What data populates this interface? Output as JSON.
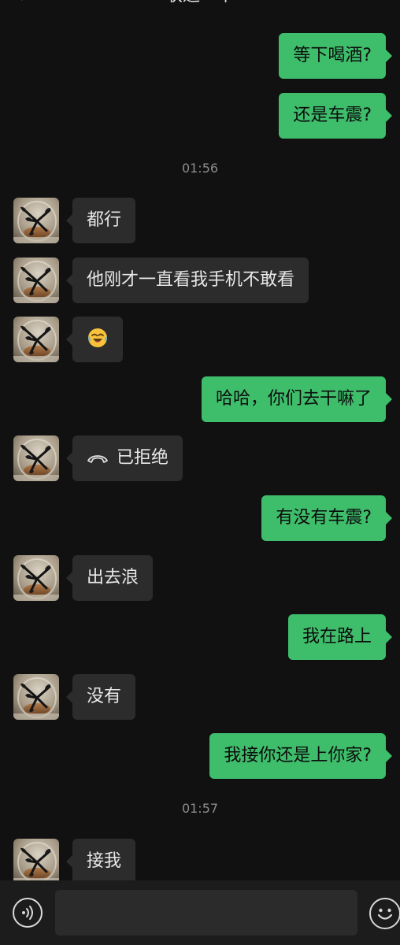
{
  "header": {
    "title": "联通一下"
  },
  "colors": {
    "background": "#111111",
    "outgoing_bubble": "#3ebd6b",
    "incoming_bubble": "#2c2c2c",
    "timestamp": "#8d8d8d"
  },
  "messages": {
    "m1": {
      "text": "等下喝酒?",
      "side": "out"
    },
    "m2": {
      "text": "还是车震?",
      "side": "out"
    },
    "t1": {
      "text": "01:56"
    },
    "m3": {
      "text": "都行",
      "side": "in"
    },
    "m4": {
      "text": "他刚才一直看我手机不敢看",
      "side": "in"
    },
    "m5": {
      "emoji": "laughing-crying-emoji",
      "side": "in"
    },
    "m6": {
      "text": "哈哈，你们去干嘛了",
      "side": "out"
    },
    "m7": {
      "text": "已拒绝",
      "icon": "hang-up-phone-icon",
      "side": "in"
    },
    "m8": {
      "text": "有没有车震?",
      "side": "out"
    },
    "m9": {
      "text": "出去浪",
      "side": "in"
    },
    "m10": {
      "text": "我在路上",
      "side": "out"
    },
    "m11": {
      "text": "没有",
      "side": "in"
    },
    "m12": {
      "text": "我接你还是上你家?",
      "side": "out"
    },
    "t2": {
      "text": "01:57"
    },
    "m13": {
      "text": "接我",
      "side": "in"
    }
  },
  "input_bar": {
    "voice_icon": "voice-icon",
    "placeholder": "",
    "emoji_icon": "smiley-icon"
  }
}
